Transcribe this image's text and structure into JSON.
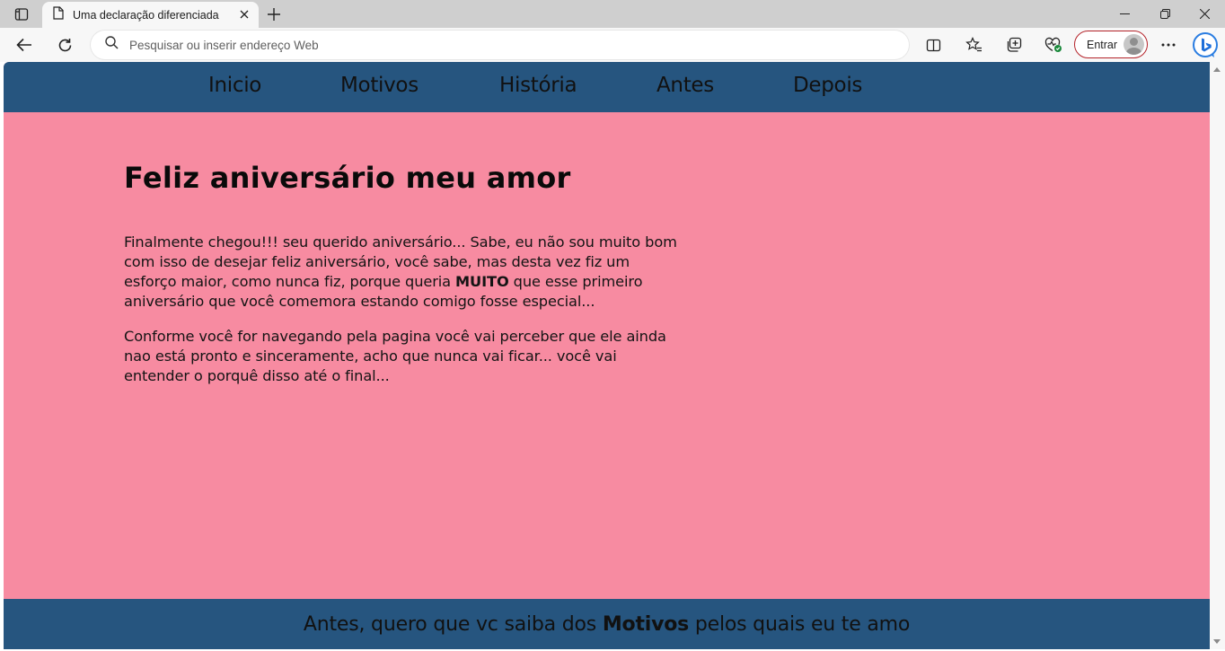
{
  "browser": {
    "tab_title": "Uma declaração diferenciada",
    "address_placeholder": "Pesquisar ou inserir endereço Web",
    "signin_label": "Entrar",
    "icons": {
      "tab_actions": "tab-actions-icon",
      "page": "page-icon",
      "close": "close-icon",
      "new_tab": "plus-icon",
      "back": "back-arrow-icon",
      "refresh": "refresh-icon",
      "search": "search-icon",
      "split": "split-screen-icon",
      "favorites": "favorites-star-icon",
      "collections": "collections-icon",
      "health": "browser-essentials-icon",
      "menu": "more-icon",
      "copilot": "bing-icon"
    }
  },
  "site": {
    "nav": [
      "Inicio",
      "Motivos",
      "História",
      "Antes",
      "Depois"
    ],
    "heading": "Feliz aniversário meu amor",
    "paragraph1": {
      "before": "Finalmente chegou!!! seu querido aniversário... Sabe, eu não sou muito bom com isso de desejar feliz aniversário, você sabe, mas desta vez fiz um esforço maior, como nunca fiz, porque queria ",
      "bold": "MUITO",
      "after": " que esse primeiro aniversário que você comemora estando comigo fosse especial..."
    },
    "paragraph2": "Conforme você for navegando pela pagina você vai perceber que ele ainda nao está pronto e sinceramente, acho que nunca vai ficar... você vai entender o porquê disso até o final...",
    "footer": {
      "before": "Antes, quero que vc saiba dos ",
      "bold": "Motivos",
      "after": " pelos quais eu te amo"
    },
    "colors": {
      "background": "#f78ba1",
      "navbar": "#26557f",
      "text": "#111111"
    }
  }
}
